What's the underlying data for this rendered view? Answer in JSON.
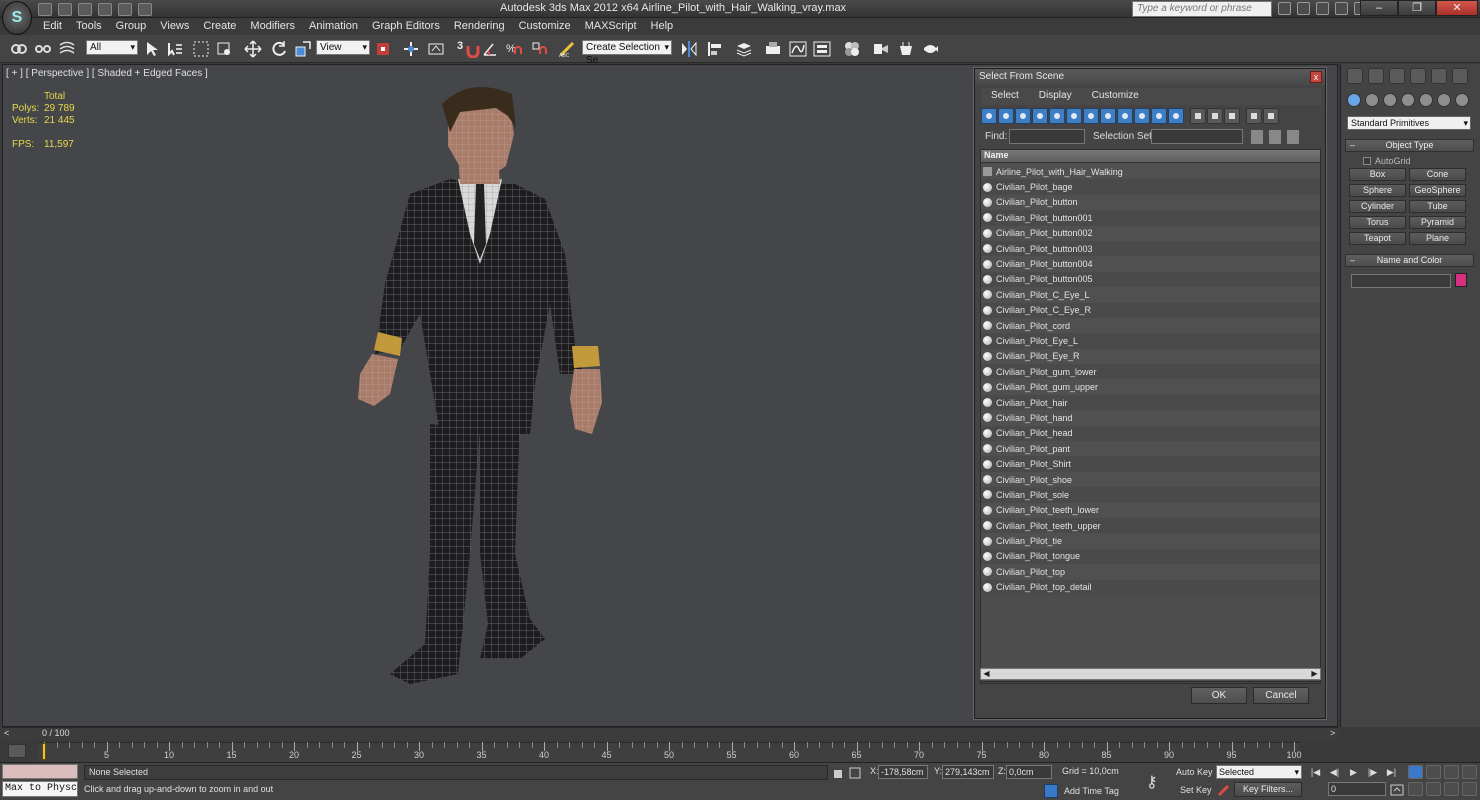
{
  "window": {
    "title": "Autodesk 3ds Max  2012 x64     Airline_Pilot_with_Hair_Walking_vray.max",
    "search_placeholder": "Type a keyword or phrase",
    "logo_letter": "S"
  },
  "menu": [
    "Edit",
    "Tools",
    "Group",
    "Views",
    "Create",
    "Modifiers",
    "Animation",
    "Graph Editors",
    "Rendering",
    "Customize",
    "MAXScript",
    "Help"
  ],
  "toolbar": {
    "filter_value": "All",
    "ref_coord_value": "View",
    "snap_label": "3",
    "selection_set_value": "Create Selection Se"
  },
  "viewport": {
    "label": "[ + ] [ Perspective ] [ Shaded + Edged Faces ]",
    "stats": {
      "total_label": "Total",
      "polys_label": "Polys:",
      "polys_value": "29 789",
      "verts_label": "Verts:",
      "verts_value": "21 445",
      "fps_label": "FPS:",
      "fps_value": "11,597"
    }
  },
  "dialog": {
    "title": "Select From Scene",
    "close": "x",
    "menu": [
      "Select",
      "Display",
      "Customize"
    ],
    "find_label": "Find:",
    "selection_set_label": "Selection Set:",
    "column_header": "Name",
    "items": [
      "Airline_Pilot_with_Hair_Walking",
      "Civilian_Pilot_bage",
      "Civilian_Pilot_button",
      "Civilian_Pilot_button001",
      "Civilian_Pilot_button002",
      "Civilian_Pilot_button003",
      "Civilian_Pilot_button004",
      "Civilian_Pilot_button005",
      "Civilian_Pilot_C_Eye_L",
      "Civilian_Pilot_C_Eye_R",
      "Civilian_Pilot_cord",
      "Civilian_Pilot_Eye_L",
      "Civilian_Pilot_Eye_R",
      "Civilian_Pilot_gum_lower",
      "Civilian_Pilot_gum_upper",
      "Civilian_Pilot_hair",
      "Civilian_Pilot_hand",
      "Civilian_Pilot_head",
      "Civilian_Pilot_pant",
      "Civilian_Pilot_Shirt",
      "Civilian_Pilot_shoe",
      "Civilian_Pilot_sole",
      "Civilian_Pilot_teeth_lower",
      "Civilian_Pilot_teeth_upper",
      "Civilian_Pilot_tie",
      "Civilian_Pilot_tongue",
      "Civilian_Pilot_top",
      "Civilian_Pilot_top_detail"
    ],
    "ok_label": "OK",
    "cancel_label": "Cancel"
  },
  "command_panel": {
    "category_value": "Standard Primitives",
    "object_type_header": "Object Type",
    "autogrid_label": "AutoGrid",
    "primitives": [
      "Box",
      "Cone",
      "Sphere",
      "GeoSphere",
      "Cylinder",
      "Tube",
      "Torus",
      "Pyramid",
      "Teapot",
      "Plane"
    ],
    "name_color_header": "Name and Color",
    "object_color": "#d4307c"
  },
  "timeline": {
    "time_label": "0 / 100",
    "ticks": [
      "0",
      "5",
      "10",
      "15",
      "20",
      "25",
      "30",
      "35",
      "40",
      "45",
      "50",
      "55",
      "60",
      "65",
      "70",
      "75",
      "80",
      "85",
      "90",
      "95",
      "100"
    ]
  },
  "status": {
    "maxscript_label": "Max to Physc",
    "selection_status": "None Selected",
    "prompt": "Click and drag up-and-down to zoom in and out",
    "x_label": "X:",
    "x_value": "-178,58cm",
    "y_label": "Y:",
    "y_value": "279,143cm",
    "z_label": "Z:",
    "z_value": "0,0cm",
    "grid_label": "Grid = 10,0cm",
    "add_time_tag_label": "Add Time Tag",
    "auto_key_label": "Auto Key",
    "auto_key_value": "Selected",
    "set_key_label": "Set Key",
    "key_filters_label": "Key Filters...",
    "frame_value": "0"
  }
}
